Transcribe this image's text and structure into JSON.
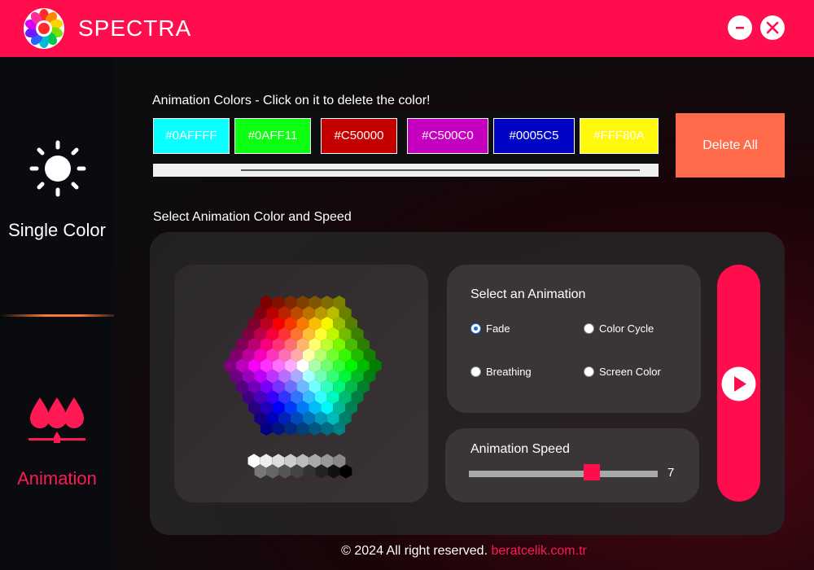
{
  "app": {
    "title": "SPECTRA",
    "brand_color": "#ff0d4d"
  },
  "window_controls": {
    "minimize_icon": "minus-icon",
    "close_icon": "close-icon"
  },
  "sidebar": {
    "items": [
      {
        "label": "Single Color",
        "icon": "sun-icon",
        "active": false
      },
      {
        "label": "Animation",
        "icon": "droplets-icon",
        "active": true
      }
    ]
  },
  "animation_colors": {
    "title": "Animation  Colors - Click on it to delete the color!",
    "chips": [
      {
        "hex": "#0AFFFF",
        "color": "#0affff"
      },
      {
        "hex": "#0AFF11",
        "color": "#0aff11"
      },
      {
        "hex": "#C50000",
        "color": "#c50000"
      },
      {
        "hex": "#C500C0",
        "color": "#c500c0"
      },
      {
        "hex": "#0005C5",
        "color": "#0005c5"
      },
      {
        "hex": "#FFF80A",
        "color": "#fff80a"
      }
    ],
    "delete_all_label": "Delete All"
  },
  "select_section": {
    "title": "Select Animation Color and Speed"
  },
  "animation_select": {
    "title": "Select an Animation",
    "options": [
      {
        "label": "Fade",
        "selected": true
      },
      {
        "label": "Color Cycle",
        "selected": false
      },
      {
        "label": "Breathing",
        "selected": false
      },
      {
        "label": "Screen Color",
        "selected": false
      }
    ]
  },
  "speed": {
    "title": "Animation Speed",
    "value": "7",
    "min": 1,
    "max": 10
  },
  "play_button": {
    "icon": "play-icon"
  },
  "footer": {
    "text": "© 2024 All right reserved.",
    "link": "beratcelik.com.tr"
  }
}
